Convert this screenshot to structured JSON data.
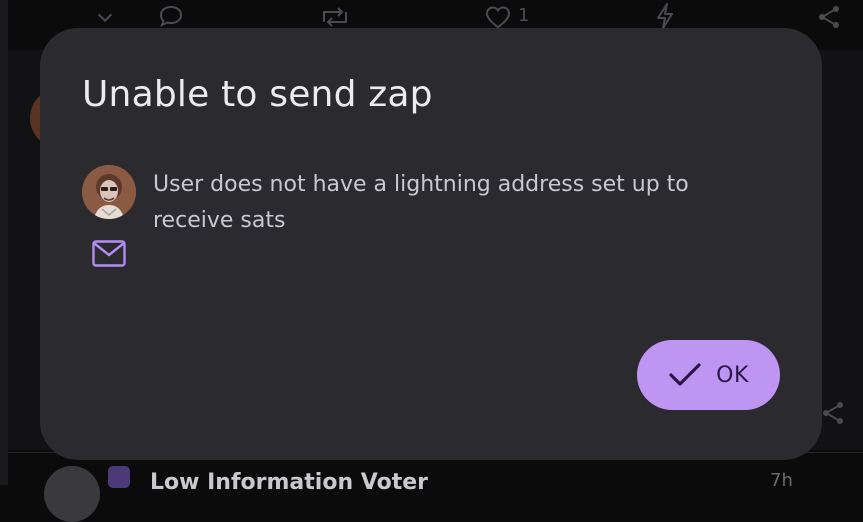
{
  "background": {
    "like_count": "1",
    "bottom_post": {
      "author_name": "Low Information Voter",
      "time": "7h"
    }
  },
  "dialog": {
    "title": "Unable to send zap",
    "message": "User does not have a lightning address set up to receive sats",
    "avatar_icon": "user-avatar",
    "message_icon": "mail-icon",
    "ok_label": "OK",
    "ok_icon": "check-icon"
  },
  "colors": {
    "dialog_bg": "#2b2a2f",
    "accent": "#bf95f3",
    "icon_accent": "#b58cf2",
    "title_text": "#ecebf0",
    "body_text": "#c9c7d0"
  }
}
